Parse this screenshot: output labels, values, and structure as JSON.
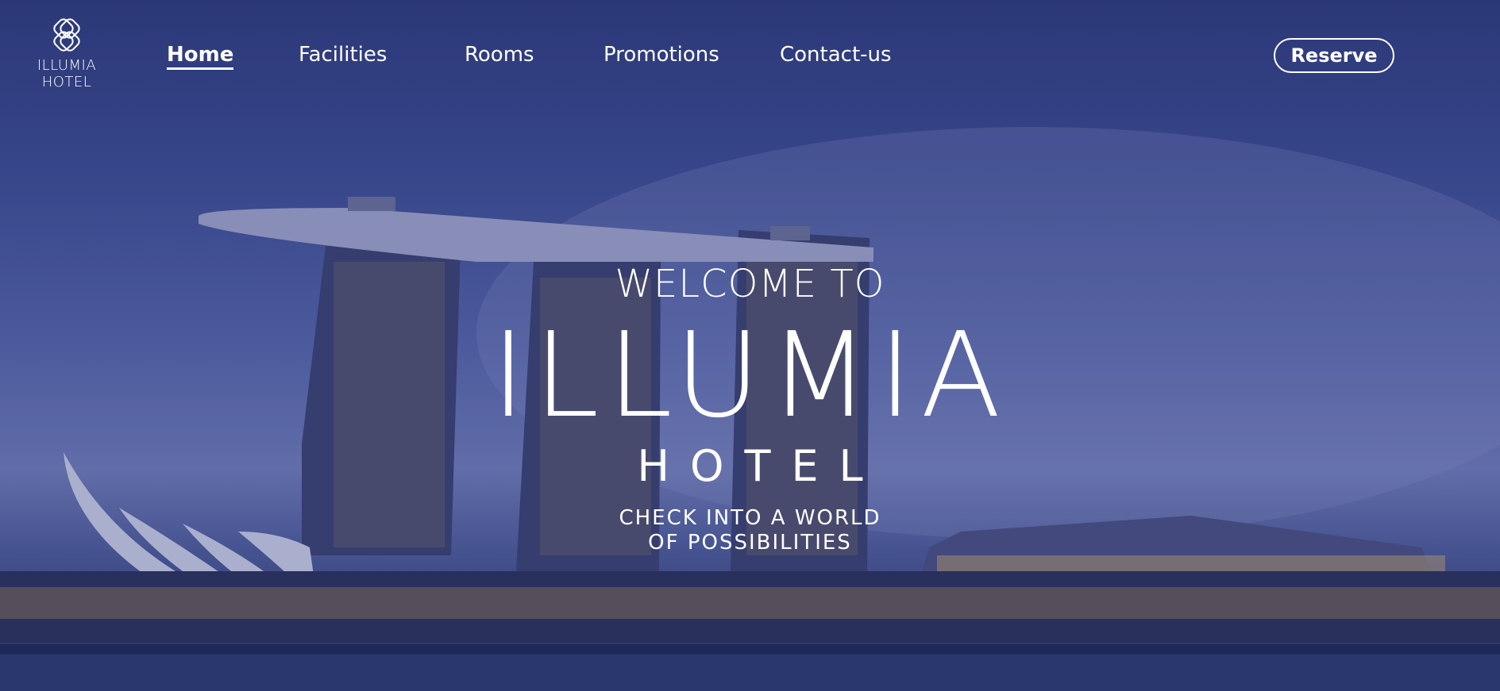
{
  "logo": {
    "text": "ILLUMIA HOTEL",
    "icon": "interlocking-ring-logo-icon"
  },
  "nav": {
    "items": [
      {
        "label": "Home",
        "active": true
      },
      {
        "label": "Facilities",
        "active": false
      },
      {
        "label": "Rooms",
        "active": false
      },
      {
        "label": "Promotions",
        "active": false
      },
      {
        "label": "Contact-us",
        "active": false
      }
    ],
    "reserve_label": "Reserve"
  },
  "hero": {
    "welcome": "WELCOME TO",
    "title": "ILLUMIA",
    "subtitle": "HOTEL",
    "tagline_line1": "CHECK INTO A WORLD",
    "tagline_line2": "OF POSSIBILITIES"
  },
  "colors": {
    "text": "#ffffff",
    "sky_top": "#2d3a7a",
    "sky_mid": "#6f7bb6",
    "water": "#202c58"
  }
}
